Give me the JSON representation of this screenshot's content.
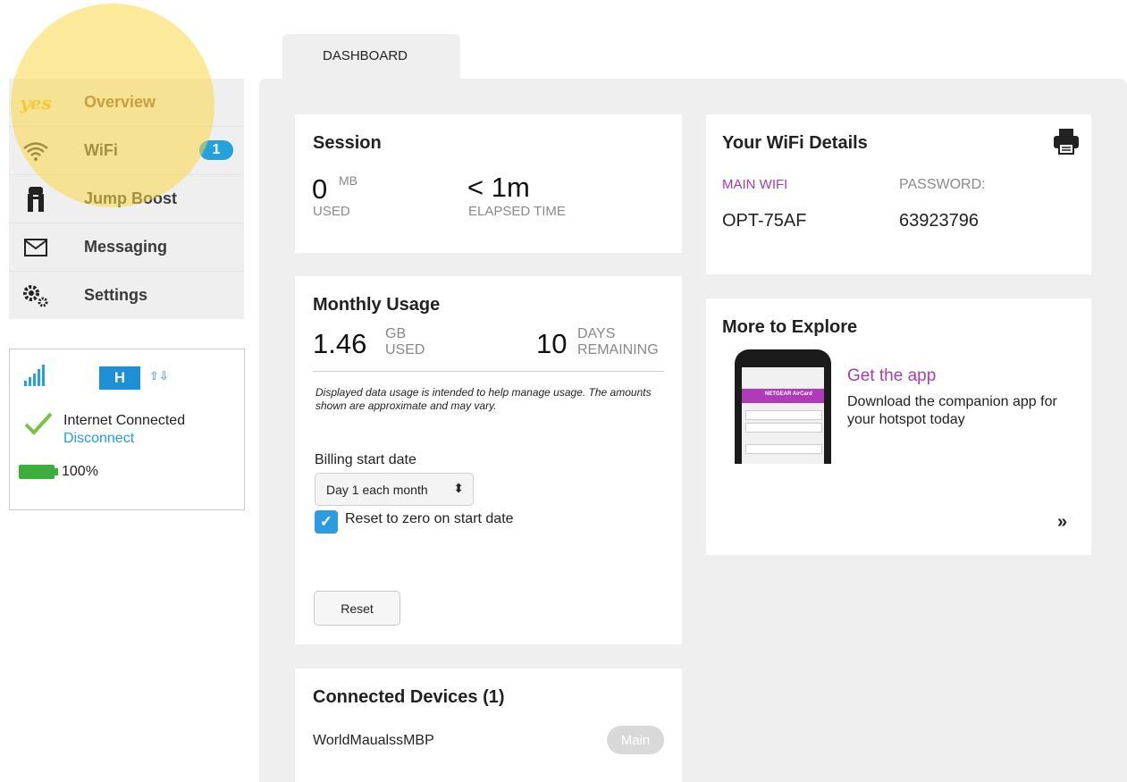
{
  "sidebar": {
    "logo_text": "yes",
    "items": [
      {
        "label": "Overview",
        "icon": "yes-logo-icon"
      },
      {
        "label": "WiFi",
        "icon": "wifi-icon",
        "badge": "1"
      },
      {
        "label": "Jump Boost",
        "icon": "jump-boost-icon"
      },
      {
        "label": "Messaging",
        "icon": "envelope-icon"
      },
      {
        "label": "Settings",
        "icon": "gears-icon"
      }
    ]
  },
  "status": {
    "network_type": "H",
    "internet_status": "Internet Connected",
    "disconnect_label": "Disconnect",
    "battery": "100%",
    "battery_level": 1.0
  },
  "tabs": [
    {
      "label": "DASHBOARD"
    }
  ],
  "session": {
    "title": "Session",
    "used_value": "0",
    "used_unit": "MB",
    "used_label": "USED",
    "elapsed_value": "< 1m",
    "elapsed_label": "ELAPSED TIME"
  },
  "monthly": {
    "title": "Monthly Usage",
    "used_value": "1.46",
    "used_unit": "GB",
    "used_label": "USED",
    "days_value": "10",
    "days_unit": "DAYS",
    "days_label": "REMAINING",
    "note": "Displayed data usage is intended to help manage usage. The amounts shown are approximate and may vary.",
    "billing_label": "Billing start date",
    "billing_value": "Day 1 each month",
    "reset_checkbox_label": "Reset to zero on start date",
    "reset_checkbox_checked": true,
    "reset_button": "Reset"
  },
  "devices": {
    "title": "Connected Devices (1)",
    "items": [
      {
        "name": "WorldMaualssMBP",
        "tag": "Main"
      }
    ]
  },
  "wifi": {
    "title": "Your WiFi Details",
    "name_label": "MAIN WIFI",
    "password_label": "PASSWORD:",
    "name_value": "OPT-75AF",
    "password_value": "63923796"
  },
  "explore": {
    "title": "More to Explore",
    "link": "Get the app",
    "description": "Download the companion app for your hotspot today",
    "more": "»",
    "phone_bar_text": "NETGEAR AirCard"
  },
  "colors": {
    "accent_blue": "#25a2db",
    "link_blue": "#1ea0dc",
    "purple": "#a63dac",
    "battery_green": "#3cae3c",
    "highlight_yellow": "#fad746"
  }
}
